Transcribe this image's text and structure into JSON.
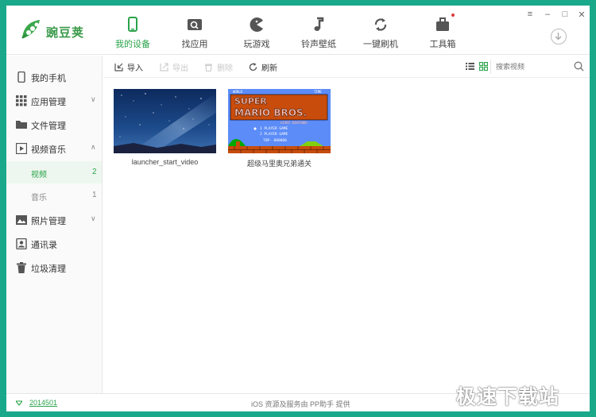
{
  "app": {
    "brand": "豌豆荚"
  },
  "nav": [
    {
      "label": "我的设备",
      "icon": "phone-icon",
      "active": true
    },
    {
      "label": "找应用",
      "icon": "search-box-icon"
    },
    {
      "label": "玩游戏",
      "icon": "pacman-icon"
    },
    {
      "label": "铃声壁纸",
      "icon": "music-note-icon"
    },
    {
      "label": "一键刷机",
      "icon": "refresh-icon"
    },
    {
      "label": "工具箱",
      "icon": "toolbox-icon"
    }
  ],
  "window_controls": [
    "≡",
    "–",
    "□",
    "✕"
  ],
  "sidebar": {
    "items": [
      {
        "label": "我的手机",
        "icon": "phone-icon"
      },
      {
        "label": "应用管理",
        "icon": "grid-icon",
        "chevron": "∨"
      },
      {
        "label": "文件管理",
        "icon": "folder-icon"
      },
      {
        "label": "视频音乐",
        "icon": "media-icon",
        "chevron": "∧"
      },
      {
        "label": "照片管理",
        "icon": "image-icon",
        "chevron": "∨"
      },
      {
        "label": "通讯录",
        "icon": "contact-icon"
      },
      {
        "label": "垃圾清理",
        "icon": "trash-icon"
      }
    ],
    "sub_items": [
      {
        "label": "视频",
        "count": "2",
        "active": true
      },
      {
        "label": "音乐",
        "count": "1"
      }
    ]
  },
  "toolbar": {
    "import_label": "导入",
    "export_label": "导出",
    "delete_label": "删除",
    "refresh_label": "刷新",
    "search_placeholder": "搜索视频"
  },
  "videos": [
    {
      "title": "launcher_start_video"
    },
    {
      "title": "超级马里奥兄弟通关"
    }
  ],
  "mario_screen": {
    "logo_line1": "SUPER",
    "logo_line2": "MARIO BROS.",
    "copyright": "©1985 NINTENDO",
    "world": "WORLD",
    "time": "TIME",
    "player1": "1 PLAYER GAME",
    "player2": "2 PLAYER GAME",
    "top": "TOP- 000000"
  },
  "status": {
    "version": "2014501",
    "service": "iOS 资源及服务由 PP助手 提供"
  },
  "watermark": "极速下载站",
  "colors": {
    "accent": "#2aa34a",
    "frame": "#1aa88a"
  }
}
